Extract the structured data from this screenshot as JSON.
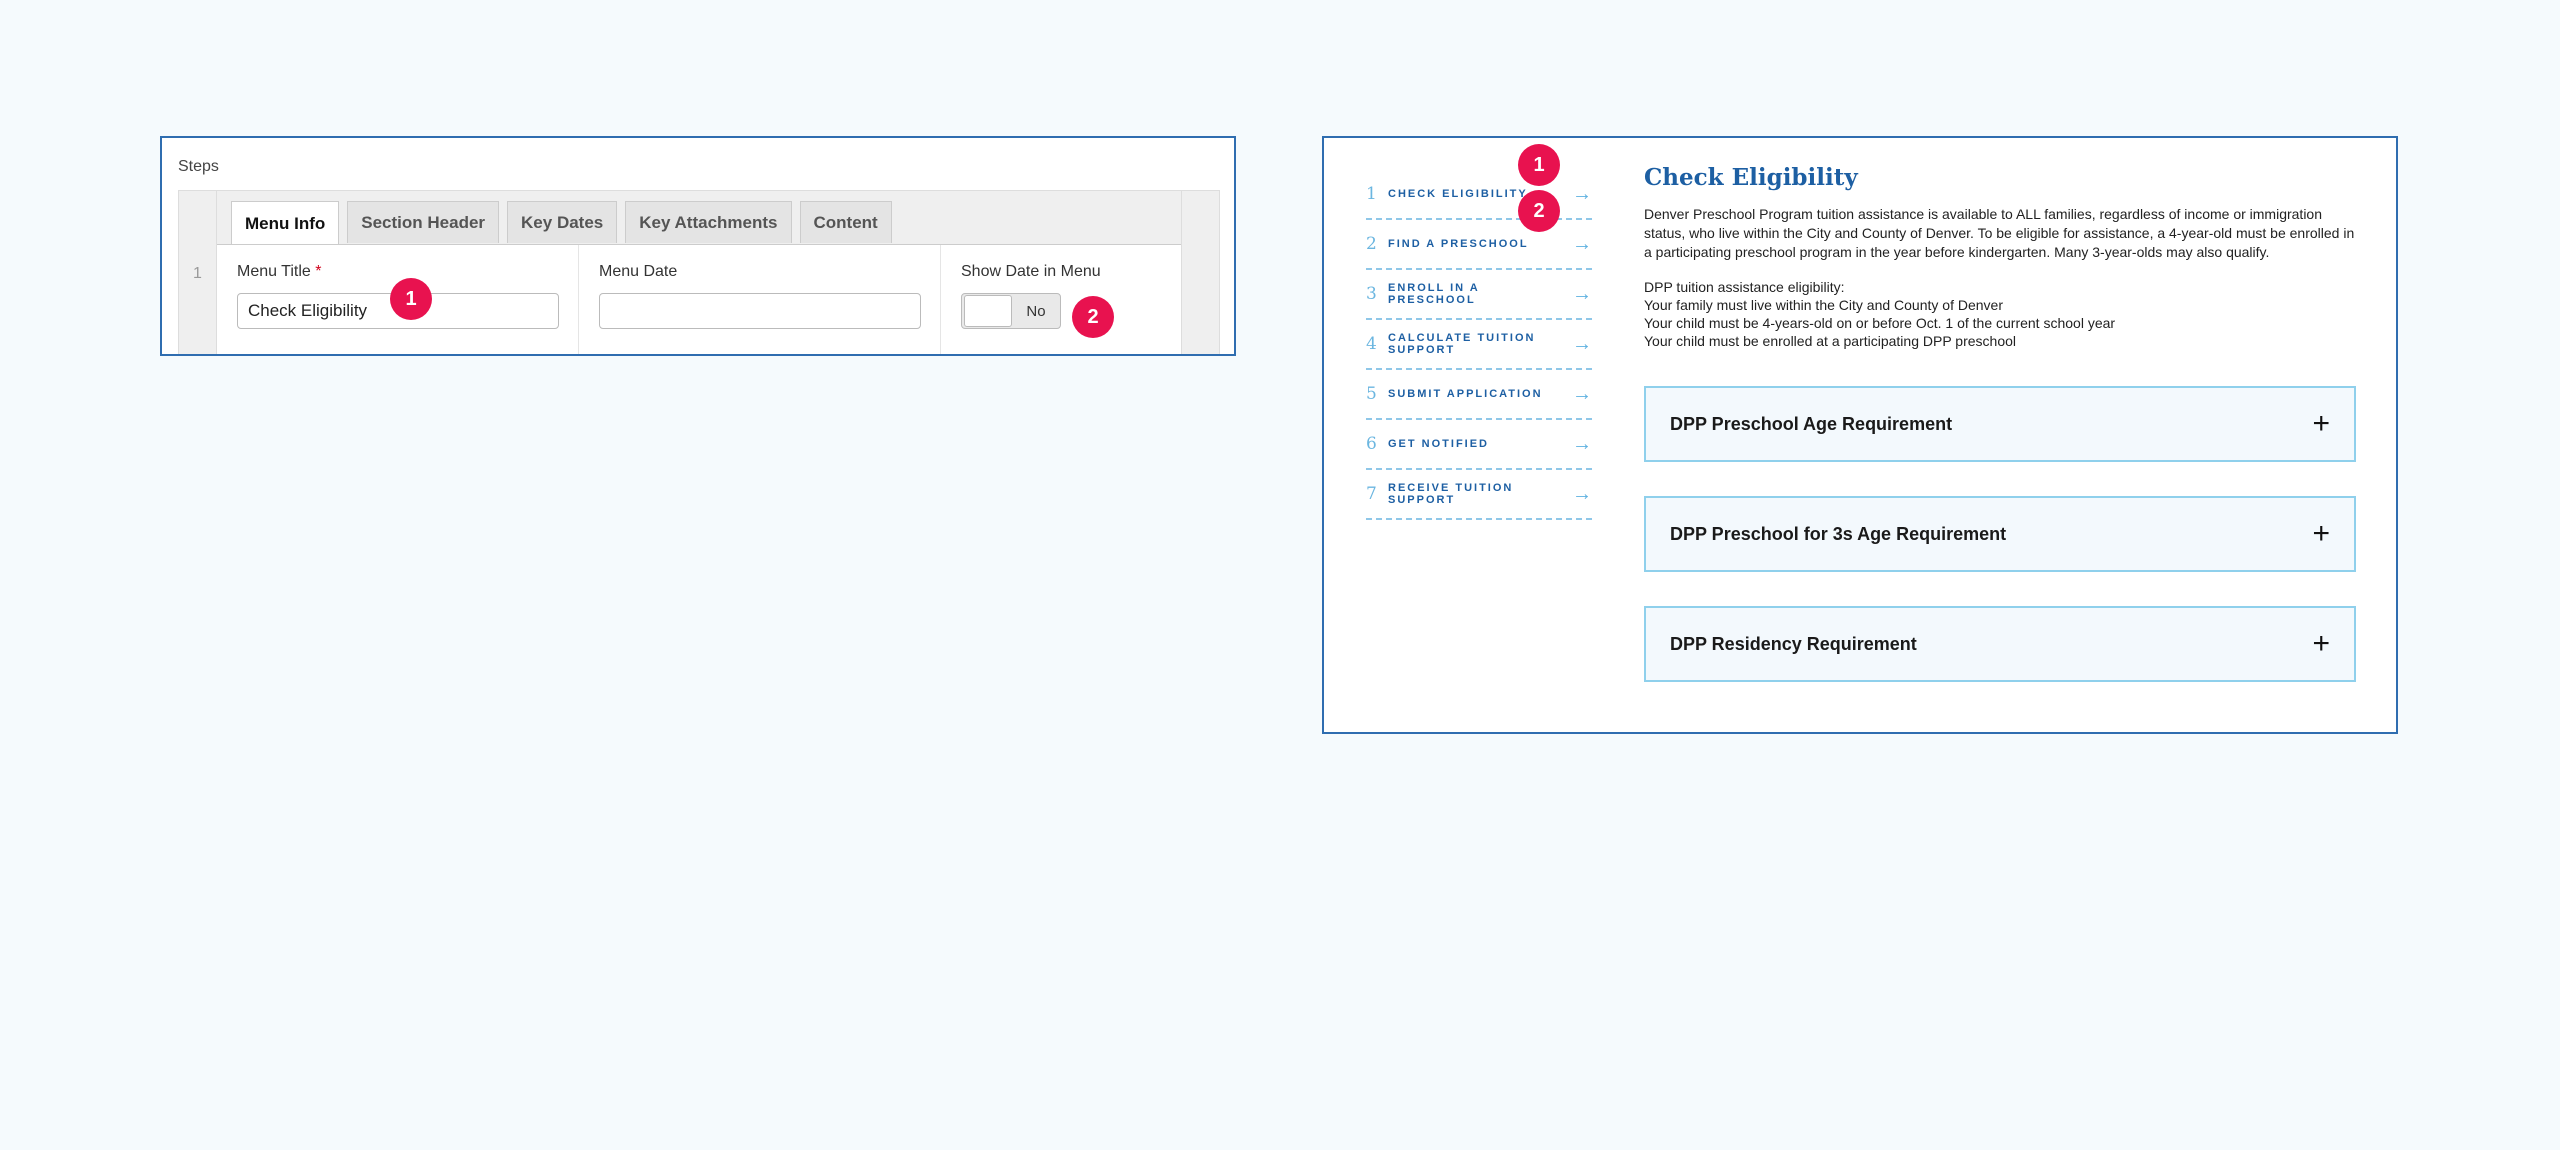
{
  "editor": {
    "steps_label": "Steps",
    "row_number": "1",
    "tabs": [
      {
        "label": "Menu Info",
        "active": true
      },
      {
        "label": "Section Header",
        "active": false
      },
      {
        "label": "Key Dates",
        "active": false
      },
      {
        "label": "Key Attachments",
        "active": false
      },
      {
        "label": "Content",
        "active": false
      }
    ],
    "menu_title": {
      "label": "Menu Title",
      "required_marker": "*",
      "value": "Check Eligibility"
    },
    "menu_date": {
      "label": "Menu Date",
      "value": ""
    },
    "show_date": {
      "label": "Show Date in Menu",
      "toggle_text": "No",
      "enabled": false
    },
    "badges": [
      "1",
      "2"
    ]
  },
  "preview": {
    "steps": [
      {
        "num": "1",
        "label": "CHECK ELIGIBILITY"
      },
      {
        "num": "2",
        "label": "FIND A PRESCHOOL"
      },
      {
        "num": "3",
        "label": "ENROLL IN A PRESCHOOL"
      },
      {
        "num": "4",
        "label": "CALCULATE TUITION SUPPORT"
      },
      {
        "num": "5",
        "label": "SUBMIT APPLICATION"
      },
      {
        "num": "6",
        "label": "GET NOTIFIED"
      },
      {
        "num": "7",
        "label": "RECEIVE TUITION SUPPORT"
      }
    ],
    "badges": [
      "1",
      "2"
    ],
    "title": "Check Eligibility",
    "intro": "Denver Preschool Program tuition assistance is available to ALL families, regardless of income or immigration status, who live within the City and County of Denver. To be eligible for assistance, a 4-year-old must be enrolled in a participating preschool program in the year before kindergarten. Many 3-year-olds may also qualify.",
    "eligibility_heading": "DPP tuition assistance eligibility:",
    "eligibility_items": [
      "Your family must live within the City and County of Denver",
      "Your child must be 4-years-old on or before Oct. 1 of the current school year",
      "Your child must be enrolled at a participating DPP preschool"
    ],
    "accordions": [
      {
        "title": "DPP Preschool Age Requirement",
        "icon": "plus-icon"
      },
      {
        "title": "DPP Preschool for 3s Age Requirement",
        "icon": "plus-icon"
      },
      {
        "title": "DPP Residency Requirement",
        "icon": "plus-icon"
      }
    ]
  },
  "colors": {
    "badge": "#e8124f",
    "brand_blue": "#1d5fa3",
    "panel_border": "#2f6db0",
    "accent_light_blue": "#8fd0ec"
  }
}
